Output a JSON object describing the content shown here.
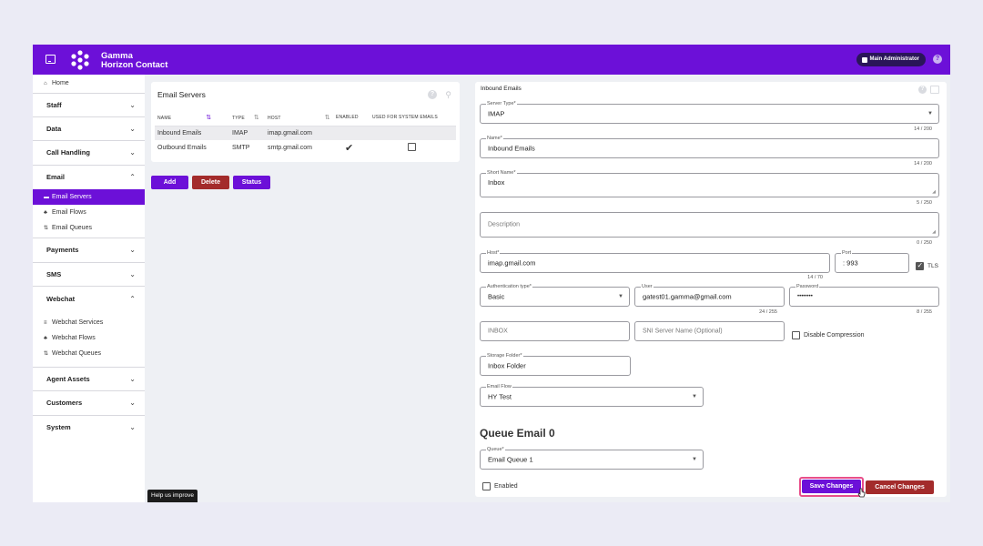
{
  "brand": {
    "line1": "Gamma",
    "line2": "Horizon Contact",
    "accent": "#6c10d8",
    "danger": "#a32b2b"
  },
  "header": {
    "user_label": "Main Administrator",
    "help": "?"
  },
  "sidebar": {
    "home": "Home",
    "sections": {
      "staff": "Staff",
      "data": "Data",
      "call_handling": "Call Handling",
      "email": "Email",
      "payments": "Payments",
      "sms": "SMS",
      "webchat": "Webchat",
      "agent_assets": "Agent Assets",
      "customers": "Customers",
      "system": "System"
    },
    "email_items": [
      "Email Servers",
      "Email Flows",
      "Email Queues"
    ],
    "webchat_items": [
      "Webchat Services",
      "Webchat Flows",
      "Webchat Queues"
    ]
  },
  "servers": {
    "title": "Email Servers",
    "columns": [
      "NAME",
      "TYPE",
      "HOST",
      "ENABLED",
      "USED FOR SYSTEM EMAILS"
    ],
    "rows": [
      {
        "name": "Inbound Emails",
        "type": "IMAP",
        "host": "imap.gmail.com",
        "enabled": "",
        "system": ""
      },
      {
        "name": "Outbound Emails",
        "type": "SMTP",
        "host": "smtp.gmail.com",
        "enabled": "checked",
        "system": "unchecked"
      }
    ]
  },
  "actions": {
    "add": "Add",
    "delete": "Delete",
    "status": "Status"
  },
  "help_improve": "Help us improve",
  "detail": {
    "title": "Inbound Emails",
    "server_type": {
      "label": "Server Type*",
      "value": "IMAP",
      "count": "14 / 200"
    },
    "name": {
      "label": "Name*",
      "value": "Inbound Emails",
      "count": "14 / 200"
    },
    "short_name": {
      "label": "Short Name*",
      "value": "Inbox",
      "count": "5 / 250"
    },
    "description": {
      "placeholder": "Description",
      "count": "0 / 250"
    },
    "host": {
      "label": "Host*",
      "value": "imap.gmail.com",
      "count": "14 / 70"
    },
    "port": {
      "label": "Port",
      "value": ": 993"
    },
    "tls": {
      "label": "TLS",
      "checked": true
    },
    "auth_type": {
      "label": "Authentication type*",
      "value": "Basic"
    },
    "user": {
      "label": "User",
      "value": "gatest01.gamma@gmail.com",
      "count": "24 / 255"
    },
    "password": {
      "label": "Password",
      "value": "••••••••",
      "count": "8 / 255"
    },
    "inbox": {
      "placeholder": "INBOX"
    },
    "sni": {
      "placeholder": "SNI Server Name (Optional)"
    },
    "disable_compression": {
      "label": "Disable Compression"
    },
    "storage_folder": {
      "label": "Storage Folder*",
      "value": "Inbox Folder"
    },
    "email_flow": {
      "label": "Email Flow",
      "value": "HY Test"
    },
    "queue_title": "Queue Email 0",
    "queue": {
      "label": "Queue*",
      "value": "Email Queue 1"
    },
    "enabled": {
      "label": "Enabled"
    },
    "save": "Save Changes",
    "cancel": "Cancel Changes"
  }
}
